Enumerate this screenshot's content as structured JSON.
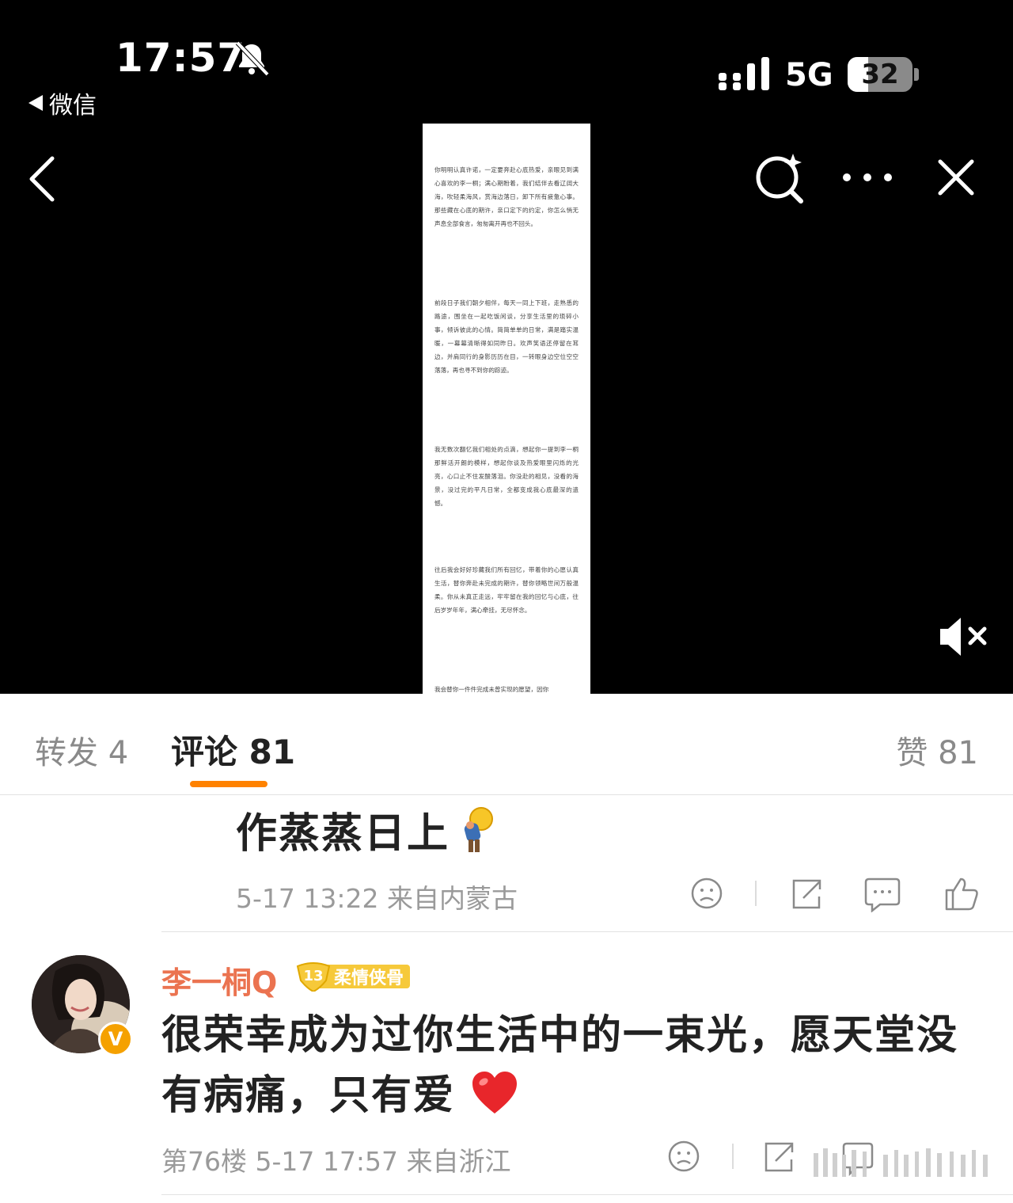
{
  "status_bar": {
    "time": "17:57",
    "back_app": "微信",
    "network": "5G",
    "battery": "32",
    "battery_level": 0.32
  },
  "document": {
    "paragraphs": [
      "你明明认真许诺，一定要奔赴心底热爱，亲眼见到满心喜欢的李一桐；满心期盼着，我们结伴去看辽阔大海，吹轻柔海风，赏海边落日，卸下所有疲惫心事。那些藏在心底的期许，亲口定下的约定，你怎么悄无声息全部食言，匆匆离开再也不回头。",
      "前段日子我们朝夕相伴，每天一同上下班，走熟悉的路途，围坐在一起吃饭闲谈，分享生活里的琐碎小事，倾诉彼此的心情。简简单单的日常，满是踏实温暖，一幕幕清晰得如同昨日。欢声笑语还停留在耳边，并肩同行的身影历历在目，一转眼身边空位空空落落，再也寻不到你的踪迹。",
      "我无数次翻忆我们相处的点滴，想起你一提到李一桐那鲜活开朗的模样，想起你谈及热爱眼里闪烁的光亮，心口止不住发酸落泪。你没赴的相见，没看的海景，没过完的平凡日常，全都变成我心底最深的遗憾。",
      "往后我会好好珍藏我们所有回忆，带着你的心愿认真生活，替你奔赴未完成的期许，替你领略世间万般温柔。你从未真正走远，牢牢留在我的回忆与心底，往后岁岁年年，满心牵挂，无尽怀念。",
      "我会替你一件件完成未曾实现的愿望，因你"
    ]
  },
  "tabs": {
    "repost": "转发 4",
    "comment": "评论 81",
    "like": "赞 81"
  },
  "comments": [
    {
      "text": "作蒸蒸日上",
      "meta": "5-17 13:22  来自内蒙古"
    },
    {
      "user": "李一桐Q",
      "fan_level": "13",
      "fan_badge": "柔情侠骨",
      "verified": "V",
      "text": "很荣幸成为过你生活中的一束光，愿天堂没有病痛，只有爱",
      "meta": "第76楼  5-17 17:57  来自浙江"
    }
  ],
  "icons": {
    "bell": "bell-off-icon",
    "search": "search-sparkle-icon",
    "more": "more-icon",
    "close": "close-icon",
    "mute": "mute-icon",
    "dislike": "dislike-icon",
    "share": "share-icon",
    "reply": "comment-icon",
    "like": "thumb-up-icon"
  },
  "colors": {
    "accent": "#ff8200",
    "username": "#eb7350",
    "badge": "#f6c93a"
  }
}
